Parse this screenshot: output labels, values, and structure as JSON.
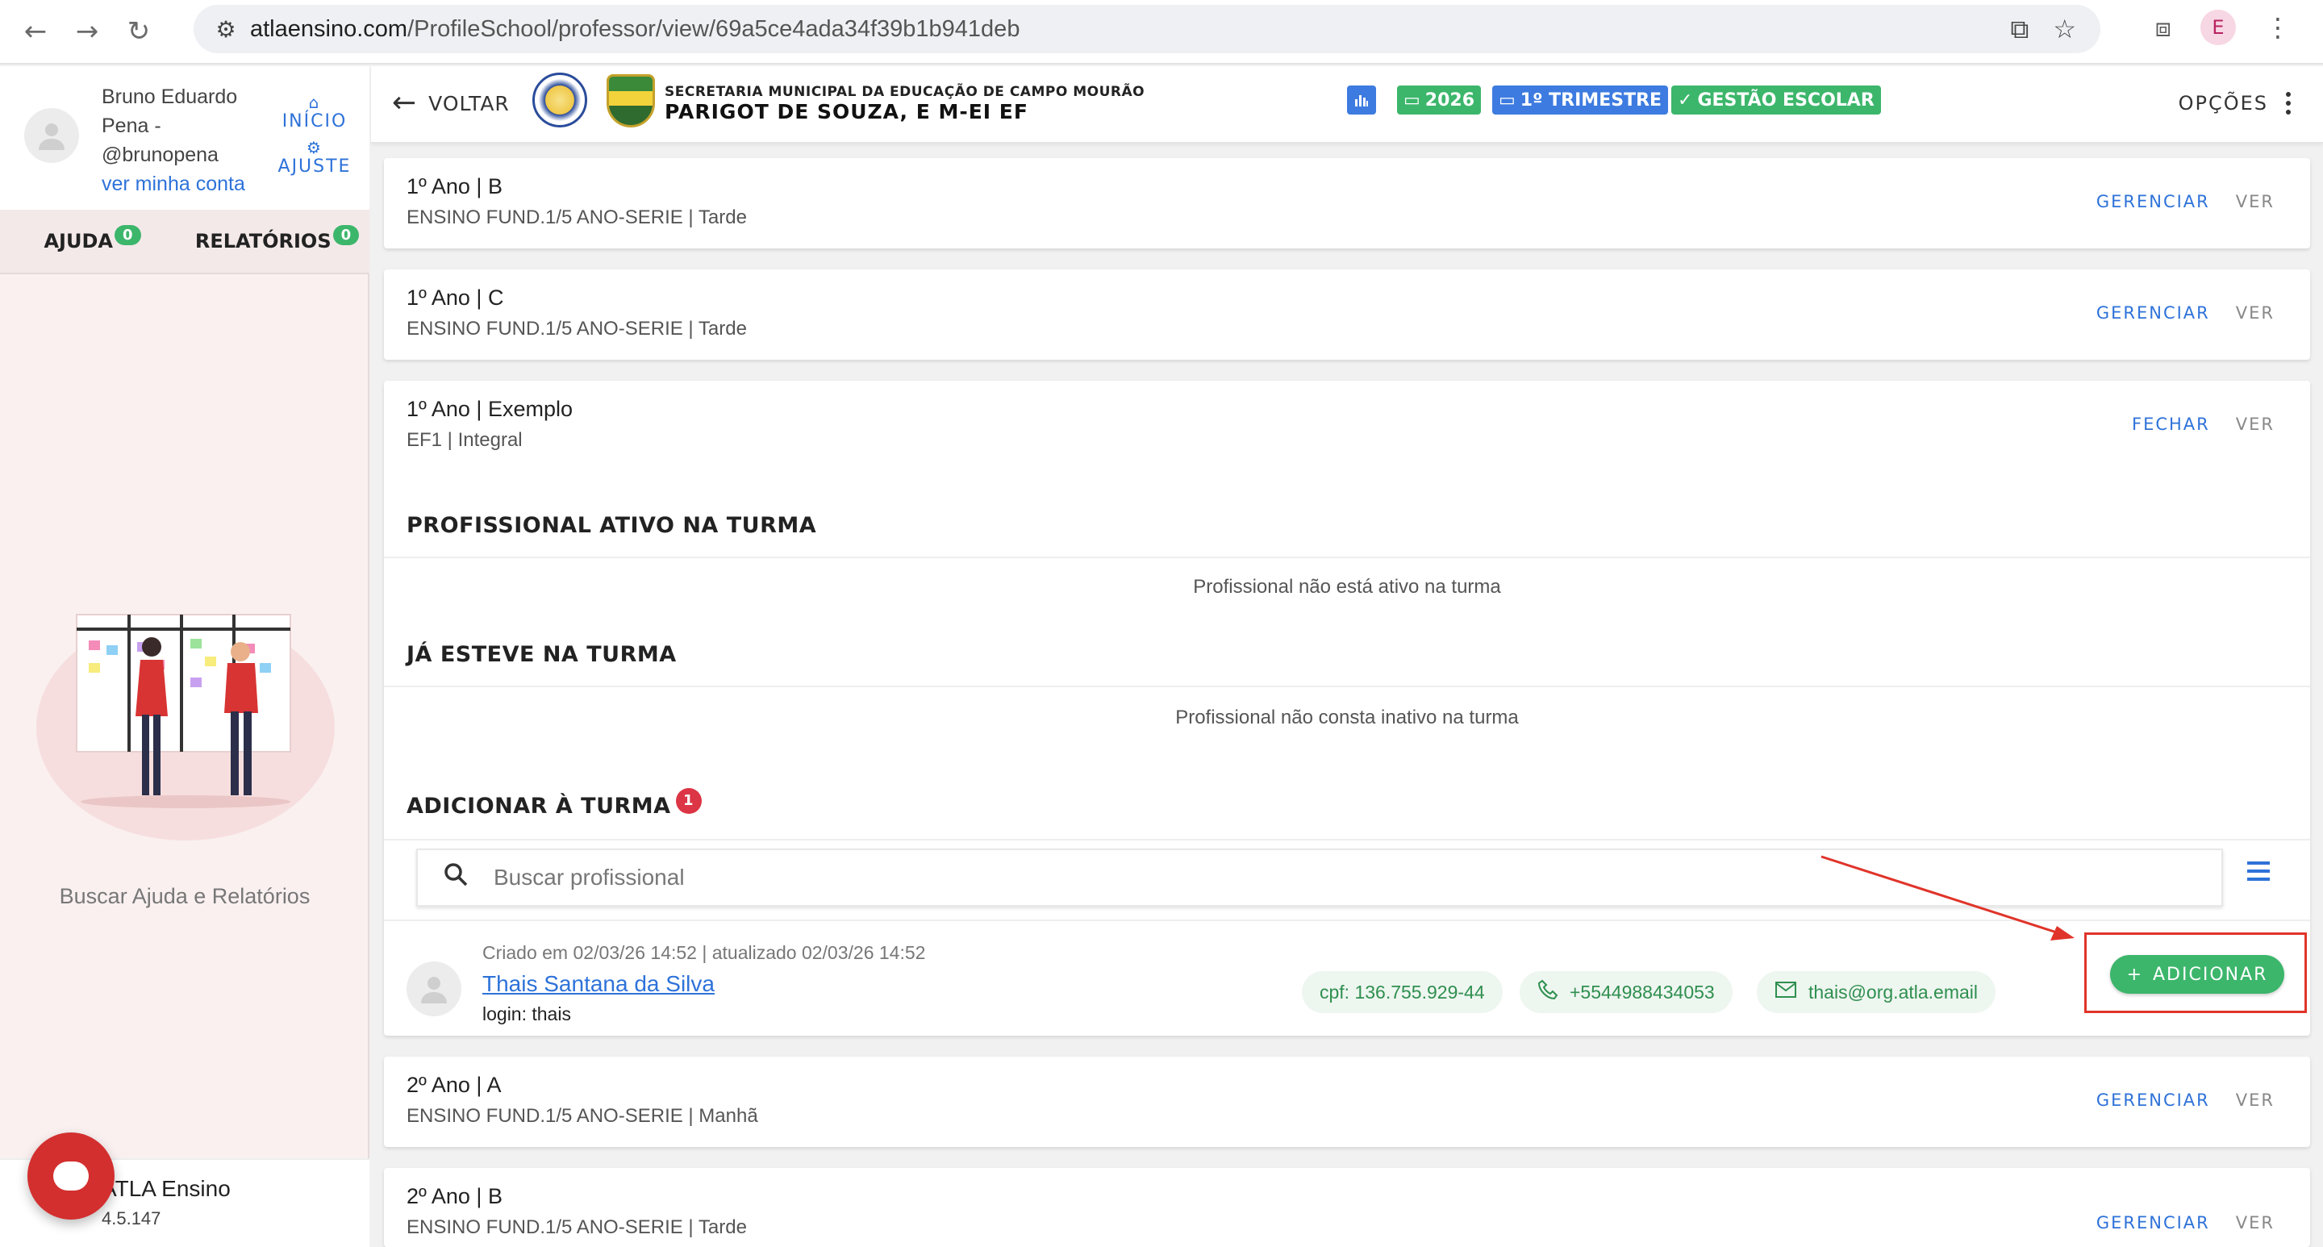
{
  "browser": {
    "url_host": "atlaensino.com",
    "url_path": "/ProfileSchool/professor/view/69a5ce4ada34f39b1b941deb",
    "profile_initial": "E"
  },
  "sidebar": {
    "user_name_line1": "Bruno Eduardo",
    "user_name_line2": "Pena -",
    "user_handle": "@brunopena",
    "account_link": "ver minha conta",
    "inicio_label": "INÍCIO",
    "ajuste_label": "AJUSTE",
    "tabs": [
      {
        "label": "AJUDA",
        "count": "0"
      },
      {
        "label": "RELATÓRIOS",
        "count": "0"
      }
    ],
    "help_text": "Buscar Ajuda e Relatórios",
    "app_name": "ATLA Ensino",
    "app_version": "4.5.147"
  },
  "header": {
    "back_label": "VOLTAR",
    "school_subtitle": "SECRETARIA MUNICIPAL DA EDUCAÇÃO DE CAMPO MOURÃO",
    "school_name": "PARIGOT DE SOUZA, E M-EI EF",
    "year_chip": "2026",
    "term_chip": "1º TRIMESTRE",
    "management_chip": "GESTÃO ESCOLAR",
    "options_label": "OPÇÕES"
  },
  "classes": [
    {
      "title": "1º Ano | B",
      "subtitle": "ENSINO FUND.1/5 ANO-SERIE | Tarde",
      "action": "GERENCIAR",
      "view": "VER"
    },
    {
      "title": "1º Ano | C",
      "subtitle": "ENSINO FUND.1/5 ANO-SERIE | Tarde",
      "action": "GERENCIAR",
      "view": "VER"
    },
    {
      "title": "1º Ano | Exemplo",
      "subtitle": "EF1 | Integral",
      "action": "FECHAR",
      "view": "VER"
    },
    {
      "title": "2º Ano | A",
      "subtitle": "ENSINO FUND.1/5 ANO-SERIE | Manhã",
      "action": "GERENCIAR",
      "view": "VER"
    },
    {
      "title": "2º Ano | B",
      "subtitle": "ENSINO FUND.1/5 ANO-SERIE | Tarde",
      "action": "GERENCIAR",
      "view": "VER"
    }
  ],
  "expanded": {
    "active_heading": "PROFISSIONAL ATIVO NA TURMA",
    "active_empty": "Profissional não está ativo na turma",
    "past_heading": "JÁ ESTEVE NA TURMA",
    "past_empty": "Profissional não consta inativo na turma",
    "add_heading": "ADICIONAR À TURMA",
    "add_count": "1",
    "search_placeholder": "Buscar profissional",
    "professional": {
      "meta": "Criado em 02/03/26 14:52 | atualizado 02/03/26 14:52",
      "name": "Thais Santana da Silva",
      "login": "login: thais",
      "cpf": "cpf: 136.755.929-44",
      "phone": "+5544988434053",
      "email": "thais@org.atla.email",
      "add_label": "ADICIONAR"
    }
  },
  "colors": {
    "accent_blue": "#2e72d9",
    "success_green": "#3cb66b",
    "alert_red": "#e0342a"
  }
}
